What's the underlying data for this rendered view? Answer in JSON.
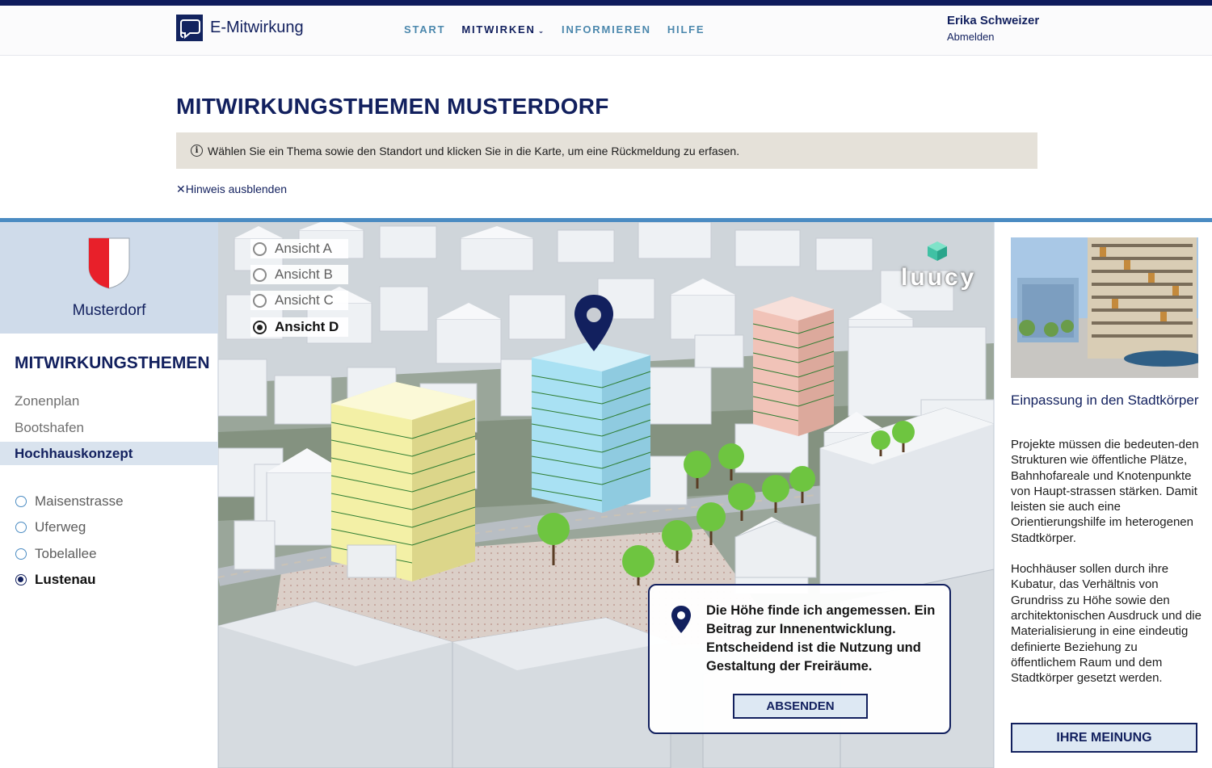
{
  "app": {
    "name": "E-Mitwirkung"
  },
  "nav": {
    "items": [
      {
        "label": "START"
      },
      {
        "label": "MITWIRKEN"
      },
      {
        "label": "INFORMIEREN"
      },
      {
        "label": "HILFE"
      }
    ],
    "active": "MITWIRKEN"
  },
  "user": {
    "name": "Erika Schweizer",
    "logout": "Abmelden"
  },
  "page": {
    "title": "MITWIRKUNGSTHEMEN MUSTERDORF",
    "hint": "Wählen Sie ein Thema sowie den Standort und klicken Sie in die Karte, um eine Rückmeldung zu erfasen.",
    "hide_hint": "Hinweis ausblenden"
  },
  "sidebar": {
    "place": "Musterdorf",
    "topics_title": "MITWIRKUNGSTHEMEN",
    "topics": [
      {
        "label": "Zonenplan"
      },
      {
        "label": "Bootshafen"
      },
      {
        "label": "Hochhauskonzept"
      }
    ],
    "active_topic": "Hochhauskonzept",
    "locations": [
      {
        "label": "Maisenstrasse"
      },
      {
        "label": "Uferweg"
      },
      {
        "label": "Tobelallee"
      },
      {
        "label": "Lustenau"
      }
    ],
    "active_location": "Lustenau"
  },
  "map": {
    "views": [
      {
        "label": "Ansicht A"
      },
      {
        "label": "Ansicht B"
      },
      {
        "label": "Ansicht C"
      },
      {
        "label": "Ansicht D"
      }
    ],
    "active_view": "Ansicht D",
    "brand": "luucy",
    "popup": {
      "text": "Die Höhe finde ich angemessen. Ein Beitrag zur Innenentwicklung. Entscheidend ist die Nutzung und Gestaltung der Freiräume.",
      "button": "ABSENDEN"
    }
  },
  "info": {
    "title": "Einpassung in den Stadtkörper",
    "paragraph1": "Projekte müssen die bedeuten-den Strukturen wie öffentliche Plätze, Bahnhofareale und Knotenpunkte von Haupt-strassen stärken. Damit leisten sie auch eine Orientierungshilfe im heterogenen Stadtkörper.",
    "paragraph2": "Hochhäuser sollen durch ihre Kubatur, das Verhältnis von Grundriss zu Höhe sowie den architektonischen Ausdruck und die Materialisierung in eine eindeutig definierte Beziehung zu öffentlichem Raum und dem Stadtkörper gesetzt werden.",
    "button": "IHRE MEINUNG"
  },
  "colors": {
    "navy": "#12205e",
    "accent_blue": "#4a8bc2",
    "nav_link": "#4c88ad",
    "hint_bg": "#e5e1d9",
    "crest_red": "#e8202a",
    "building_yellow": "#f3f0a6",
    "building_blue": "#a9e1f3",
    "building_pink": "#f1c3b8"
  },
  "icons": [
    "logo-speech-bubble-icon",
    "chevron-down-icon",
    "info-icon",
    "close-icon",
    "coat-of-arms-icon",
    "map-pin-icon",
    "luucy-cube-icon"
  ]
}
